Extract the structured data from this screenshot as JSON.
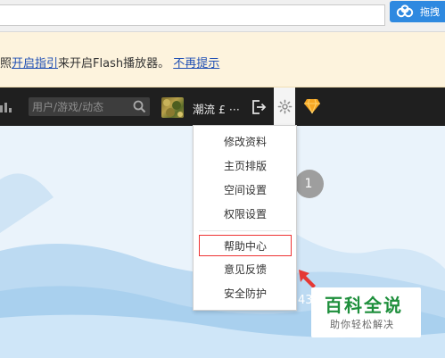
{
  "browser": {
    "extension_label": "拖拽",
    "extension_icon": "cloud-icon"
  },
  "notice": {
    "prefix": "照",
    "link1": "开启指引",
    "middle": "来开启Flash播放器。",
    "link2": "不再提示"
  },
  "nav": {
    "search_placeholder": "用户/游戏/动态",
    "username": "潮流 £ ···"
  },
  "menu": {
    "items": [
      {
        "label": "修改资料"
      },
      {
        "label": "主页排版"
      },
      {
        "label": "空间设置"
      },
      {
        "label": "权限设置"
      },
      {
        "label": "帮助中心"
      },
      {
        "label": "意见反馈"
      },
      {
        "label": "安全防护"
      }
    ],
    "highlighted_index": 4
  },
  "background": {
    "badge_count": "1",
    "partial_number": "43"
  },
  "watermark": {
    "title": "百科全说",
    "subtitle": "助你轻松解决"
  },
  "colors": {
    "nav_bg": "#1f1f1f",
    "notice_bg": "#fdf3dd",
    "link": "#1f4fb4",
    "highlight_border": "#ee3333",
    "arrow": "#e53935",
    "watermark_green": "#1e8f3c",
    "diamond": "#f5a623"
  }
}
